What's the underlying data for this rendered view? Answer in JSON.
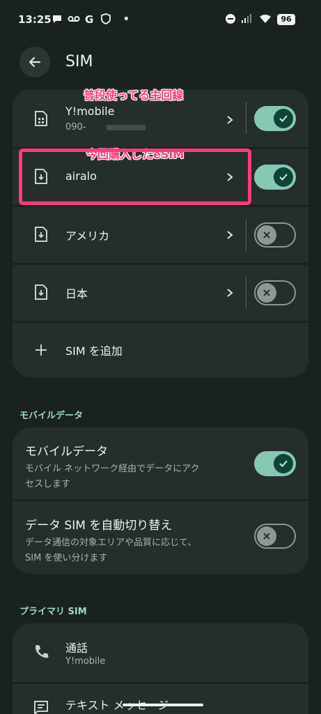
{
  "status_bar": {
    "time": "13:25",
    "battery": "96"
  },
  "header": {
    "title": "SIM"
  },
  "annotations": {
    "main_line": "普段使ってる主回線",
    "new_esim": "今回購入したeSIM"
  },
  "sims": [
    {
      "name": "Y!mobile",
      "number": "090-",
      "enabled": true,
      "icon": "sim-card-icon"
    },
    {
      "name": "airalo",
      "enabled": true,
      "icon": "esim-download-icon"
    },
    {
      "name": "アメリカ",
      "enabled": false,
      "icon": "esim-download-icon"
    },
    {
      "name": "日本",
      "enabled": false,
      "icon": "esim-download-icon"
    }
  ],
  "add_sim": {
    "label": "SIM を追加"
  },
  "mobile_data_section": {
    "header": "モバイルデータ",
    "mobile_data": {
      "title": "モバイルデータ",
      "subtitle_line1": "モバイル ネットワーク経由でデータにアク",
      "subtitle_line2": "セスします",
      "enabled": true
    },
    "auto_switch": {
      "title": "データ SIM を自動切り替え",
      "subtitle_line1": "データ通信の対象エリアや品質に応じて、",
      "subtitle_line2": "SIM を使い分けます",
      "enabled": false
    }
  },
  "primary_sim_section": {
    "header": "プライマリ SIM",
    "calls": {
      "title": "通話",
      "subtitle": "Y!mobile"
    },
    "text": {
      "title": "テキスト メッセージ"
    }
  },
  "colors": {
    "accent": "#86c8b4",
    "annotation": "#ff3a80",
    "card": "#252e2b",
    "background": "#1a2220"
  }
}
